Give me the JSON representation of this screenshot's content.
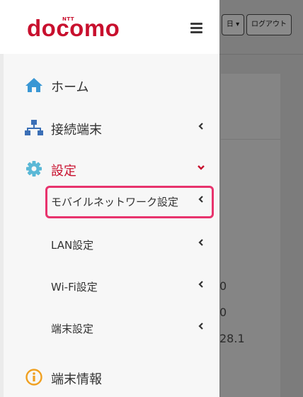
{
  "background": {
    "lang_button": "日 ▾",
    "logout_button": "ログアウト",
    "fragments": [
      "0",
      "0",
      "28.1"
    ]
  },
  "header": {
    "logo_brand": "docomo",
    "logo_prefix": "NTT"
  },
  "menu": {
    "items": [
      {
        "label": "ホーム",
        "icon": "home-icon"
      },
      {
        "label": "接続端末",
        "icon": "network-icon"
      },
      {
        "label": "設定",
        "icon": "gear-icon"
      },
      {
        "label": "モバイルネットワーク設定",
        "icon": "chevron-left-icon"
      },
      {
        "label": "LAN設定",
        "icon": "chevron-left-icon"
      },
      {
        "label": "Wi-Fi設定",
        "icon": "chevron-left-icon"
      },
      {
        "label": "端末設定",
        "icon": "chevron-left-icon"
      },
      {
        "label": "端末情報",
        "icon": "info-icon"
      }
    ]
  },
  "colors": {
    "brand": "#c8102e",
    "highlight_border": "#e8336d",
    "home_icon": "#3a97d4",
    "network_icon": "#3b6fb6",
    "gear_icon": "#5ab8d6",
    "info_icon": "#f0a020"
  }
}
